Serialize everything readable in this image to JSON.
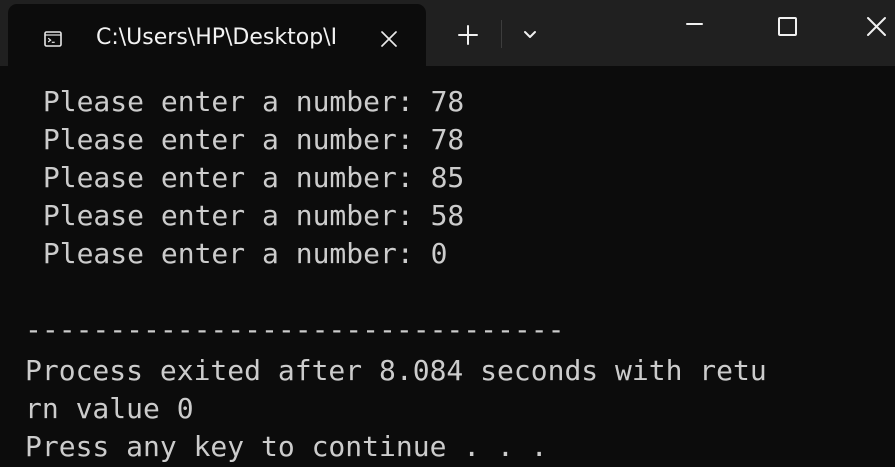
{
  "window": {
    "tab_title": "C:\\Users\\HP\\Desktop\\I",
    "icons": {
      "tab": "command-prompt-icon",
      "close_tab": "close-icon",
      "new_tab": "plus-icon",
      "dropdown": "chevron-down-icon",
      "minimize": "minimize-icon",
      "maximize": "maximize-icon",
      "close_window": "close-icon"
    },
    "colors": {
      "title_bar": "#202020",
      "console_background": "#0c0c0c",
      "console_text": "#cccccc"
    }
  },
  "console": {
    "lines": [
      " Please enter a number: 78",
      " Please enter a number: 78",
      " Please enter a number: 85",
      " Please enter a number: 58",
      " Please enter a number: 0",
      "--------------------------------",
      "Process exited after 8.084 seconds with retu",
      "rn value 0",
      "Press any key to continue . . ."
    ]
  }
}
